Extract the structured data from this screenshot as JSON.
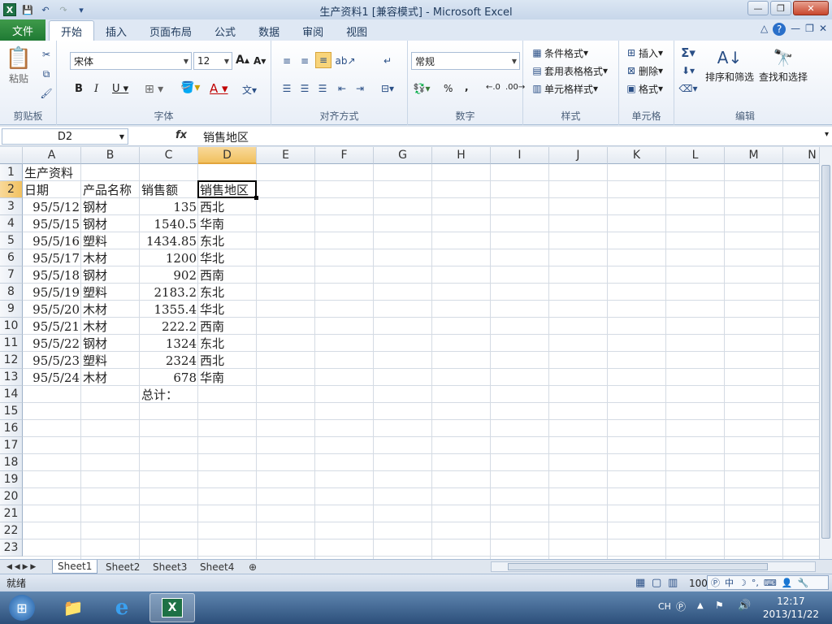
{
  "window": {
    "title": "生产资料1  [兼容模式]  -  Microsoft Excel"
  },
  "ribbon_tabs": {
    "file": "文件",
    "tabs": [
      "开始",
      "插入",
      "页面布局",
      "公式",
      "数据",
      "审阅",
      "视图"
    ]
  },
  "ribbon": {
    "clipboard": {
      "label": "剪贴板",
      "paste": "粘贴"
    },
    "font": {
      "label": "字体",
      "name": "宋体",
      "size": "12"
    },
    "align": {
      "label": "对齐方式"
    },
    "number": {
      "label": "数字",
      "format": "常规"
    },
    "styles": {
      "label": "样式",
      "cond": "条件格式",
      "table": "套用表格格式",
      "cellstyle": "单元格样式"
    },
    "cells": {
      "label": "单元格",
      "insert": "插入",
      "delete": "删除",
      "format": "格式"
    },
    "edit": {
      "label": "编辑",
      "sort": "排序和筛选",
      "find": "查找和选择"
    }
  },
  "formula_bar": {
    "name_box": "D2",
    "fx": "fx",
    "content": "销售地区"
  },
  "columns": [
    "A",
    "B",
    "C",
    "D",
    "E",
    "F",
    "G",
    "H",
    "I",
    "J",
    "K",
    "L",
    "M",
    "N"
  ],
  "rows": [
    "1",
    "2",
    "3",
    "4",
    "5",
    "6",
    "7",
    "8",
    "9",
    "10",
    "11",
    "12",
    "13",
    "14",
    "15",
    "16",
    "17",
    "18",
    "19",
    "20",
    "21",
    "22",
    "23"
  ],
  "cells": {
    "A1": "生产资料",
    "A2": "日期",
    "B2": "产品名称",
    "C2": "销售额",
    "D2": "销售地区",
    "data": [
      [
        "95/5/12",
        "钢材",
        "135",
        "西北"
      ],
      [
        "95/5/15",
        "钢材",
        "1540.5",
        "华南"
      ],
      [
        "95/5/16",
        "塑料",
        "1434.85",
        "东北"
      ],
      [
        "95/5/17",
        "木材",
        "1200",
        "华北"
      ],
      [
        "95/5/18",
        "钢材",
        "902",
        "西南"
      ],
      [
        "95/5/19",
        "塑料",
        "2183.2",
        "东北"
      ],
      [
        "95/5/20",
        "木材",
        "1355.4",
        "华北"
      ],
      [
        "95/5/21",
        "木材",
        "222.2",
        "西南"
      ],
      [
        "95/5/22",
        "钢材",
        "1324",
        "东北"
      ],
      [
        "95/5/23",
        "塑料",
        "2324",
        "西北"
      ],
      [
        "95/5/24",
        "木材",
        "678",
        "华南"
      ]
    ],
    "C14": "总计："
  },
  "sheets": [
    "Sheet1",
    "Sheet2",
    "Sheet3",
    "Sheet4"
  ],
  "status": {
    "ready": "就绪",
    "zoom": "100"
  },
  "taskbar": {
    "lang": "CH",
    "time": "12:17",
    "date": "2013/11/22"
  }
}
